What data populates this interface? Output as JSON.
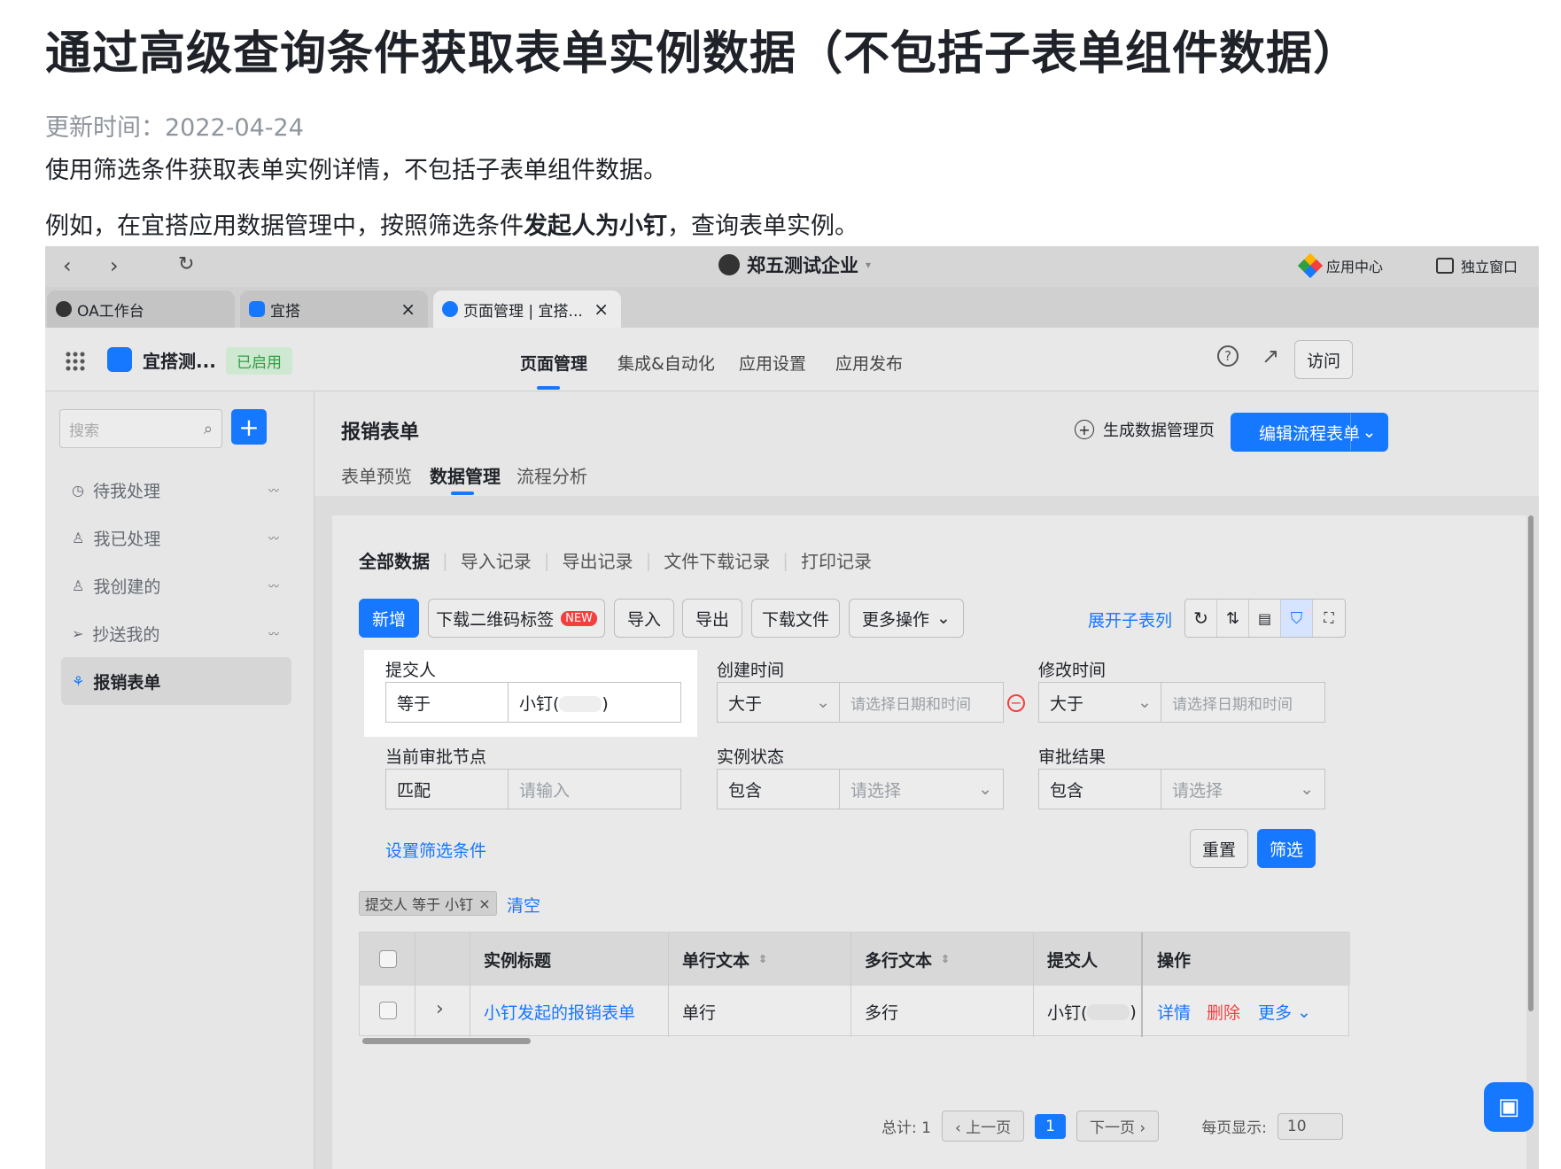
{
  "doc": {
    "title": "通过高级查询条件获取表单实例数据（不包括子表单组件数据）",
    "date": "更新时间：2022-04-24",
    "intro": "使用筛选条件获取表单实例详情，不包括子表单组件数据。",
    "example_pre": "例如，在宜搭应用数据管理中，按照筛选条件",
    "example_bold": "发起人为小钉",
    "example_post": "，查询表单实例。"
  },
  "browser": {
    "org": "郑五测试企业",
    "app_center": "应用中心",
    "standalone": "独立窗口",
    "tabs": [
      {
        "label": "OA工作台"
      },
      {
        "label": "宜搭"
      },
      {
        "label": "页面管理 | 宜搭..."
      }
    ]
  },
  "app": {
    "name": "宜搭测...",
    "status": "已启用",
    "nav": [
      "页面管理",
      "集成&自动化",
      "应用设置",
      "应用发布"
    ],
    "visit": "访问"
  },
  "sidebar": {
    "search_placeholder": "搜索",
    "items": [
      {
        "label": "待我处理"
      },
      {
        "label": "我已处理"
      },
      {
        "label": "我创建的"
      },
      {
        "label": "抄送我的"
      },
      {
        "label": "报销表单"
      }
    ]
  },
  "form": {
    "title": "报销表单",
    "gen_page": "生成数据管理页",
    "edit_btn": "编辑流程表单",
    "tabs": [
      "表单预览",
      "数据管理",
      "流程分析"
    ]
  },
  "data": {
    "subtabs": [
      "全部数据",
      "导入记录",
      "导出记录",
      "文件下载记录",
      "打印记录"
    ],
    "toolbar": {
      "add": "新增",
      "qr": "下载二维码标签",
      "new_badge": "NEW",
      "import": "导入",
      "export": "导出",
      "download": "下载文件",
      "more": "更多操作",
      "expand": "展开子表列"
    },
    "filters": [
      {
        "label": "提交人",
        "op": "等于",
        "value": "小钉(",
        "value_end": ")"
      },
      {
        "label": "创建时间",
        "op": "大于",
        "value": "请选择日期和时间"
      },
      {
        "label": "修改时间",
        "op": "大于",
        "value": "请选择日期和时间"
      },
      {
        "label": "当前审批节点",
        "op": "匹配",
        "value": "请输入"
      },
      {
        "label": "实例状态",
        "op": "包含",
        "value": "请选择"
      },
      {
        "label": "审批结果",
        "op": "包含",
        "value": "请选择"
      }
    ],
    "set_filter": "设置筛选条件",
    "reset": "重置",
    "filter": "筛选",
    "chip": "提交人 等于 小钉",
    "clear": "清空",
    "columns": [
      "实例标题",
      "单行文本",
      "多行文本",
      "提交人",
      "操作"
    ],
    "row": {
      "title": "小钉发起的报销表单",
      "single": "单行",
      "multi": "多行",
      "submitter": "小钉(",
      "submitter_end": ")",
      "detail": "详情",
      "delete": "删除",
      "more": "更多"
    },
    "pager": {
      "total": "总计: 1",
      "prev": "上一页",
      "page": "1",
      "next": "下一页",
      "per_page": "每页显示:",
      "size": "10"
    }
  },
  "colors": {
    "accent": "#1677ff",
    "danger": "#f53f3f",
    "status_green": "#2ea043"
  }
}
